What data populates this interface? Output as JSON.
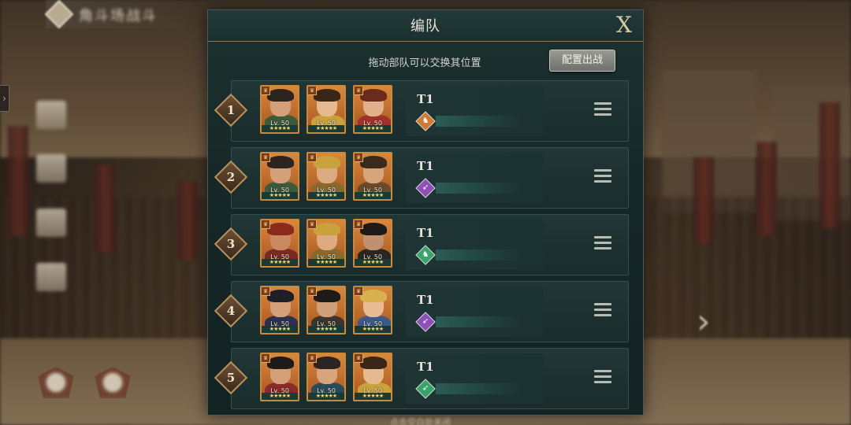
{
  "background": {
    "blurred_title": "角斗场战斗",
    "left_toggle_icon": "chevron-right-icon",
    "right_arrow_icon": "chevron-right-icon",
    "bottom_blurred_text": "点击空白处关闭"
  },
  "panel": {
    "title": "编队",
    "close_label": "X",
    "hint": "拖动部队可以交换其位置",
    "deploy_button": "配置出战"
  },
  "colors": {
    "panel_bg": "#172828",
    "hero_frame": "#c98a3c",
    "gold": "#b9915a"
  },
  "squads": [
    {
      "number": "1",
      "tier": "T1",
      "troop_type": "cavalry",
      "troop_color": "#d07a33",
      "troop_glyph": "♞",
      "heroes": [
        {
          "level": "Lv. 50",
          "stars": "★★★★★",
          "hair": "#2b2420",
          "body": "#3d5a3a",
          "skin": "#d3a07a"
        },
        {
          "level": "Lv. 50",
          "stars": "★★★★★",
          "hair": "#3a2618",
          "body": "#c9a23c",
          "skin": "#e6b98f"
        },
        {
          "level": "Lv. 50",
          "stars": "★★★★★",
          "hair": "#6a2a1c",
          "body": "#a3302a",
          "skin": "#e2b08a"
        }
      ]
    },
    {
      "number": "2",
      "tier": "T1",
      "troop_type": "archer",
      "troop_color": "#8f4fb8",
      "troop_glyph": "➶",
      "heroes": [
        {
          "level": "Lv. 50",
          "stars": "★★★★★",
          "hair": "#2b2420",
          "body": "#3d5a3a",
          "skin": "#d3a07a"
        },
        {
          "level": "Lv. 50",
          "stars": "★★★★★",
          "hair": "#c9a23c",
          "body": "#8a6a2c",
          "skin": "#dcaa80"
        },
        {
          "level": "Lv. 50",
          "stars": "★★★★★",
          "hair": "#3a2a1c",
          "body": "#6a4a2a",
          "skin": "#d7a47c"
        }
      ]
    },
    {
      "number": "3",
      "tier": "T1",
      "troop_type": "cavalry",
      "troop_color": "#3aa36a",
      "troop_glyph": "♞",
      "heroes": [
        {
          "level": "Lv. 50",
          "stars": "★★★★★",
          "hair": "#8a2a1c",
          "body": "#7a2a22",
          "skin": "#c98a62"
        },
        {
          "level": "Lv. 50",
          "stars": "★★★★★",
          "hair": "#c9a23c",
          "body": "#8a6a2c",
          "skin": "#dcaa80"
        },
        {
          "level": "Lv. 50",
          "stars": "★★★★★",
          "hair": "#1e1a18",
          "body": "#2a2622",
          "skin": "#c09070"
        }
      ]
    },
    {
      "number": "4",
      "tier": "T1",
      "troop_type": "archer",
      "troop_color": "#8f4fb8",
      "troop_glyph": "➶",
      "heroes": [
        {
          "level": "Lv. 50",
          "stars": "★★★★★",
          "hair": "#1e1e28",
          "body": "#2a3050",
          "skin": "#d3a07a"
        },
        {
          "level": "Lv. 50",
          "stars": "★★★★★",
          "hair": "#1e1a18",
          "body": "#3a342e",
          "skin": "#cfa07c"
        },
        {
          "level": "Lv. 50",
          "stars": "★★★★★",
          "hair": "#d9b050",
          "body": "#3a5a8a",
          "skin": "#e8bc92"
        }
      ]
    },
    {
      "number": "5",
      "tier": "T1",
      "troop_type": "archer",
      "troop_color": "#3aa36a",
      "troop_glyph": "➶",
      "heroes": [
        {
          "level": "Lv. 50",
          "stars": "★★★★★",
          "hair": "#1e1a18",
          "body": "#8a2a2a",
          "skin": "#d3a07a"
        },
        {
          "level": "Lv. 50",
          "stars": "★★★★★",
          "hair": "#2b2420",
          "body": "#2a4a5a",
          "skin": "#d7a47c"
        },
        {
          "level": "Lv. 50",
          "stars": "★★★★★",
          "hair": "#3a2618",
          "body": "#c9a23c",
          "skin": "#e6b98f"
        }
      ]
    }
  ]
}
